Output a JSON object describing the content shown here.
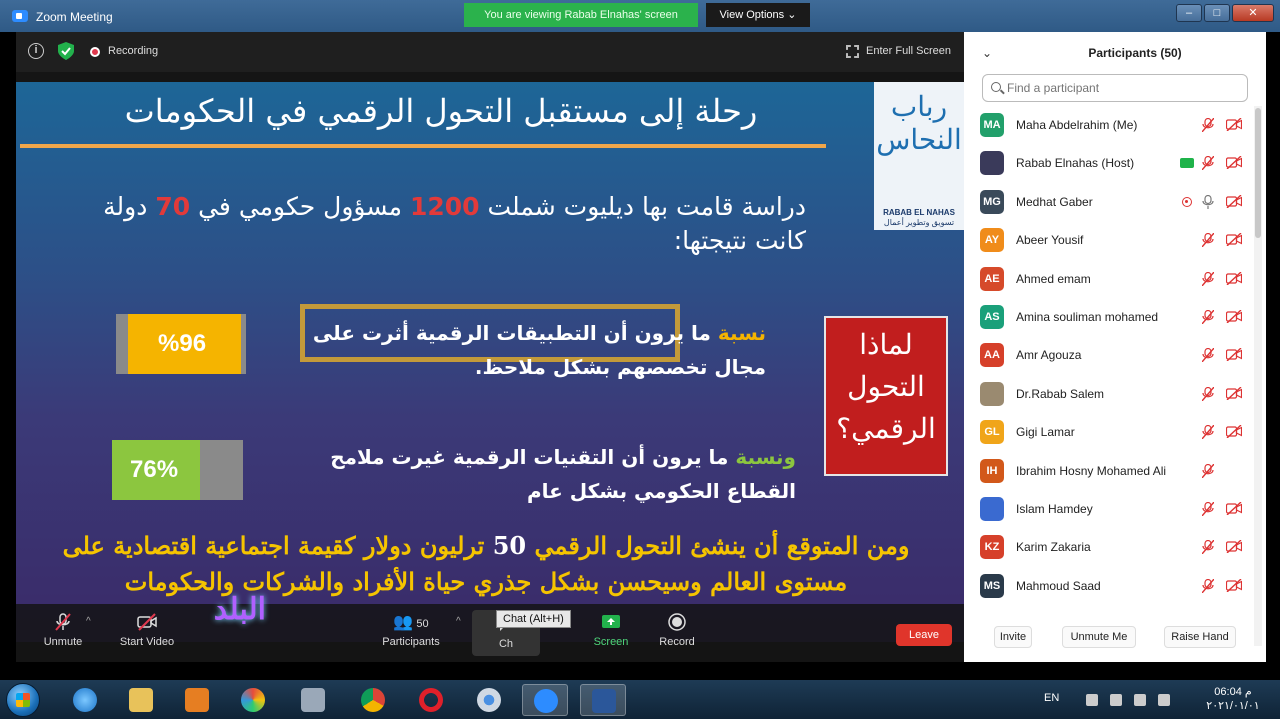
{
  "window": {
    "title": "Zoom Meeting",
    "share_banner": "You are viewing Rabab Elnahas' screen",
    "view_options": "View Options",
    "min": "–",
    "max": "□",
    "close": "✕"
  },
  "meeting_top": {
    "recording": "Recording",
    "full_screen": "Enter Full Screen"
  },
  "slide": {
    "title": "رحلة إلى مستقبل التحول الرقمي في الحكومات",
    "logo_ar": "رباب النحاس",
    "logo_en": "RABAB EL NAHAS",
    "logo_sub": "تسويق وتطوير أعمال",
    "study_pre": "دراسة قامت بها ديليوت شملت ",
    "study_n1": "1200",
    "study_mid": " مسؤول حكومي في ",
    "study_n2": "70",
    "study_post": " دولة كانت نتيجتها:",
    "why": "لماذا التحول الرقمي؟",
    "stat1_accent": "نسبة",
    "stat1_text": " ما يرون أن التطبيقات الرقمية أثرت على مجال تخصصهم بشكل ملاحظ.",
    "stat2_accent": "ونسبة",
    "stat2_text": " ما يرون أن التقنيات الرقمية غيرت ملامح القطاع الحكومي بشكل عام",
    "bottom_pre": "ومن المتوقع أن ينشئ التحول الرقمي ",
    "bottom_num": "50",
    "bottom_post": " ترليون دولار كقيمة اجتماعية اقتصادية على مستوى العالم وسيحسن بشكل جذري حياة الأفراد والشركات والحكومات",
    "bar1_label": "%96",
    "bar2_label": "76%",
    "bar1_value": 96,
    "bar2_value": 76
  },
  "toolbar": {
    "unmute": "Unmute",
    "start_video": "Start Video",
    "participants": "Participants",
    "participants_count": "50",
    "chat": "Ch",
    "share_screen": "Screen",
    "record": "Record",
    "leave": "Leave",
    "tooltip": "Chat (Alt+H)",
    "channel_logo": "البلد"
  },
  "panel": {
    "title": "Participants (50)",
    "search_placeholder": "Find a participant",
    "participants": [
      {
        "initials": "MA",
        "name": "Maha Abdelrahim (Me)",
        "color": "#22a06b"
      },
      {
        "initials": "",
        "name": "Rabab Elnahas (Host)",
        "color": "#3a3a5a"
      },
      {
        "initials": "MG",
        "name": "Medhat Gaber",
        "color": "#3a4a5a"
      },
      {
        "initials": "AY",
        "name": "Abeer Yousif",
        "color": "#f08c1a"
      },
      {
        "initials": "AE",
        "name": "Ahmed emam",
        "color": "#d64a2a"
      },
      {
        "initials": "AS",
        "name": "Amina souliman mohamed",
        "color": "#1aa07a"
      },
      {
        "initials": "AA",
        "name": "Amr Agouza",
        "color": "#d6402a"
      },
      {
        "initials": "",
        "name": "Dr.Rabab Salem",
        "color": "#9a8a70"
      },
      {
        "initials": "GL",
        "name": "Gigi Lamar",
        "color": "#f0a51a"
      },
      {
        "initials": "IH",
        "name": "Ibrahim Hosny Mohamed Ali",
        "color": "#d2581a"
      },
      {
        "initials": "",
        "name": "Islam Hamdey",
        "color": "#3a6ad0"
      },
      {
        "initials": "KZ",
        "name": "Karim Zakaria",
        "color": "#d6402a"
      },
      {
        "initials": "MS",
        "name": "Mahmoud Saad",
        "color": "#2a3a4a"
      }
    ],
    "invite": "Invite",
    "unmute_me": "Unmute Me",
    "raise_hand": "Raise Hand"
  },
  "taskbar": {
    "lang": "EN",
    "time": "06:04 م",
    "date": "٢٠٢١/٠١/٠١"
  }
}
